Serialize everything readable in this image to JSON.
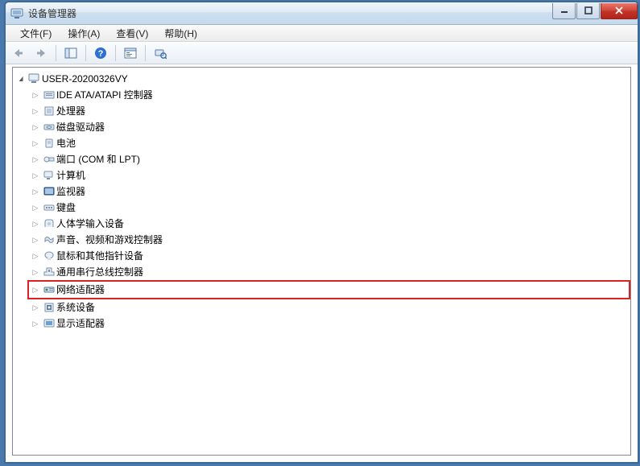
{
  "window": {
    "title": "设备管理器"
  },
  "menu": {
    "file": "文件(F)",
    "action": "操作(A)",
    "view": "查看(V)",
    "help": "帮助(H)"
  },
  "tree": {
    "root": "USER-20200326VY",
    "items": [
      "IDE ATA/ATAPI 控制器",
      "处理器",
      "磁盘驱动器",
      "电池",
      "端口 (COM 和 LPT)",
      "计算机",
      "监视器",
      "键盘",
      "人体学输入设备",
      "声音、视频和游戏控制器",
      "鼠标和其他指针设备",
      "通用串行总线控制器",
      "网络适配器",
      "系统设备",
      "显示适配器"
    ],
    "highlighted_index": 12
  }
}
